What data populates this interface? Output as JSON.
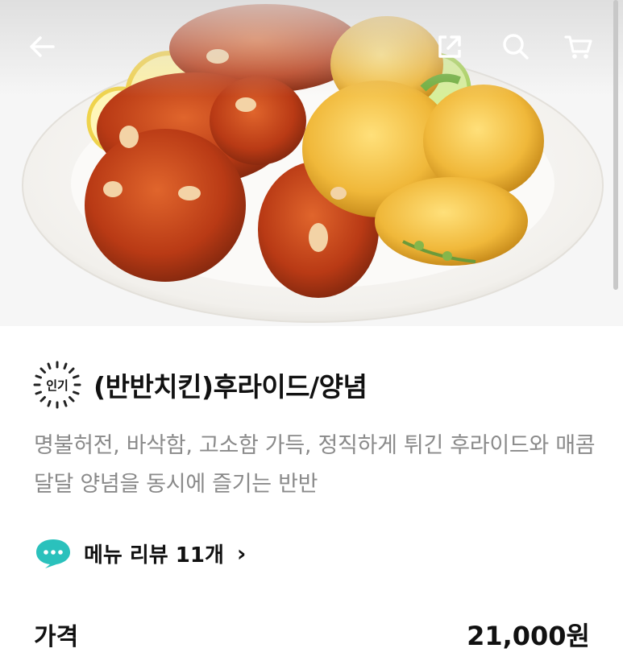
{
  "header": {
    "back_icon": "arrow-left-icon",
    "share_icon": "share-icon",
    "search_icon": "search-icon",
    "cart_icon": "cart-icon"
  },
  "hero": {
    "image": "fried-chicken-half-and-half-photo"
  },
  "product": {
    "badge": "인기",
    "title": "(반반치킨)후라이드/양념",
    "description": "명불허전, 바삭함, 고소함 가득, 정직하게 튀긴 후라이드와 매콤달달 양념을 동시에 즐기는 반반"
  },
  "reviews": {
    "label": "메뉴 리뷰 11개",
    "chevron": "›",
    "icon_color": "#2ac1bc"
  },
  "price": {
    "label": "가격",
    "value": "21,000원"
  }
}
